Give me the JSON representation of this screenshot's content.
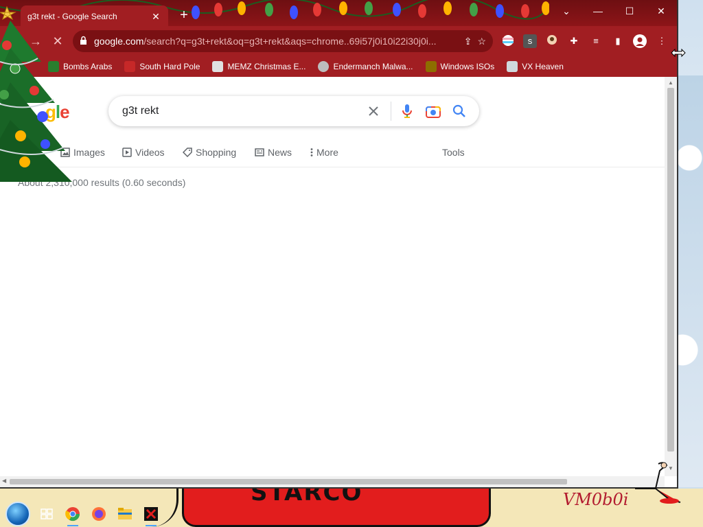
{
  "browser": {
    "tab_title": "g3t rekt - Google Search",
    "new_tab_label": "+",
    "url_domain": "google.com",
    "url_rest": "/search?q=g3t+rekt&oq=g3t+rekt&aqs=chrome..69i57j0i10i22i30j0i...",
    "window_controls": [
      "chevron-down-icon",
      "minimize-icon",
      "maximize-icon",
      "close-icon"
    ]
  },
  "bookmarks": [
    {
      "label": "Bombs Arabs",
      "icon": "flag-icon",
      "color": "#2a7d2e"
    },
    {
      "label": "South Hard Pole",
      "icon": "snowflake-icon",
      "color": "#c62828"
    },
    {
      "label": "MEMZ Christmas E...",
      "icon": "image-icon",
      "color": "#e0e0e0"
    },
    {
      "label": "Endermanch Malwa...",
      "icon": "wolf-icon",
      "color": "#bdbdbd"
    },
    {
      "label": "Windows ISOs",
      "icon": "person-icon",
      "color": "#8d6e00"
    },
    {
      "label": "VX Heaven",
      "icon": "shield-icon",
      "color": "#cfd8dc"
    }
  ],
  "search": {
    "query": "g3t rekt",
    "logo_text": "gle"
  },
  "search_tabs": [
    {
      "label": "Images",
      "icon": "image-icon"
    },
    {
      "label": "Videos",
      "icon": "play-icon"
    },
    {
      "label": "Shopping",
      "icon": "tag-icon"
    },
    {
      "label": "News",
      "icon": "news-icon"
    },
    {
      "label": "More",
      "icon": "more-vert-icon"
    }
  ],
  "tools_label": "Tools",
  "result_stats": "About 2,310,000 results (0.60 seconds)",
  "desktop": {
    "banner_text": "STARCO",
    "signature_text": "VM0b0i"
  },
  "colors": {
    "chrome_theme": "#a11e22",
    "titlebar": "#7a1013",
    "google_blue": "#4285f4",
    "google_red": "#ea4335",
    "google_yellow": "#fbbc05",
    "google_green": "#34a853"
  }
}
